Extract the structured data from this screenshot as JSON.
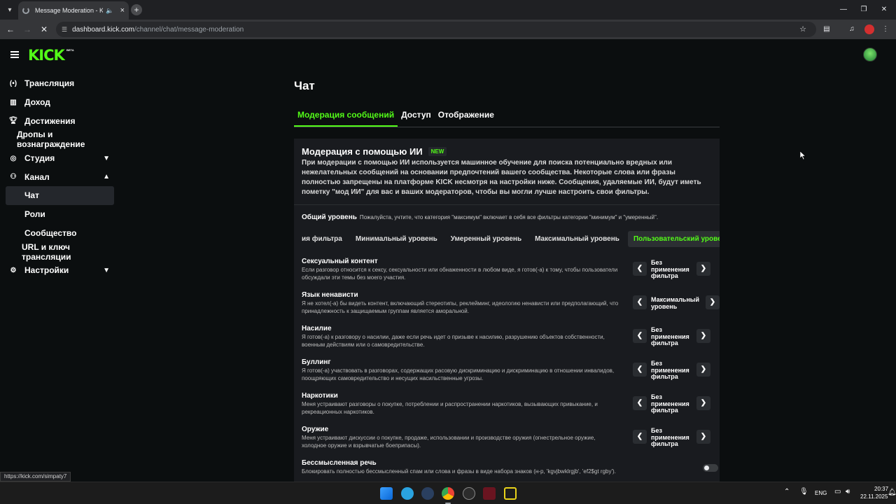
{
  "browser": {
    "tab_title": "Message Moderation - Kick",
    "url_host": "dashboard.kick.com",
    "url_path": "/channel/chat/message-moderation",
    "status_url": "https://kick.com/simpaty7",
    "icons": [
      "tab-list-icon",
      "loading-spinner-icon",
      "audio-icon",
      "close-icon",
      "new-tab-icon",
      "back-icon",
      "forward-icon",
      "stop-icon",
      "site-info-icon",
      "star-icon",
      "tab-search-icon",
      "media-icon",
      "profile-icon",
      "menu-icon",
      "minimize-icon",
      "restore-icon",
      "close-window-icon"
    ]
  },
  "header": {
    "logo": "KICK",
    "beta": "BETA"
  },
  "sidebar": {
    "items": [
      {
        "label": "Трансляция",
        "icon": "broadcast-icon"
      },
      {
        "label": "Доход",
        "icon": "income-icon"
      },
      {
        "label": "Достижения",
        "icon": "trophy-icon"
      },
      {
        "label": "Дропы и вознаграждение"
      },
      {
        "label": "Студия",
        "icon": "studio-icon"
      },
      {
        "label": "Канал",
        "icon": "channel-icon"
      },
      {
        "label": "Чат"
      },
      {
        "label": "Роли"
      },
      {
        "label": "Сообщество"
      },
      {
        "label": "URL и ключ трансляции"
      },
      {
        "label": "Настройки",
        "icon": "gear-icon"
      }
    ]
  },
  "main": {
    "title": "Чат",
    "tabs": [
      "Модерация сообщений",
      "Доступ",
      "Отображение"
    ],
    "ai": {
      "title": "Модерация с помощью ИИ",
      "badge": "NEW",
      "description": "При модерации с помощью ИИ используется машинное обучение для поиска потенциально вредных или нежелательных сообщений на основании предпочтений вашего сообщества. Некоторые слова или фразы полностью запрещены на платформе KICK несмотря на настройки ниже. Сообщения, удаляемые ИИ, будут иметь пометку \"мод ИИ\" для вас и ваших модераторов, чтобы вы могли лучше настроить свои фильтры."
    },
    "level": {
      "title": "Общий уровень",
      "note": "Пожалуйста, учтите, что категория \"максимум\" включает в себя все фильтры категории \"минимум\" и \"умеренный\"."
    },
    "presets": [
      "ия фильтра",
      "Минимальный уровень",
      "Умеренный уровень",
      "Максимальный уровень",
      "Пользовательский уровень"
    ],
    "categories": [
      {
        "name": "Сексуальный контент",
        "desc": "Если разговор относится к сексу, сексуальности или обнаженности в любом виде, я готов(-а) к тому, чтобы пользователи обсуждали эти темы без моего участия.",
        "value": "Без применения фильтра"
      },
      {
        "name": "Язык ненависти",
        "desc": "Я не хотел(-а) бы видеть контент, включающий стереотипы, реклейминг, идеологию ненависти или предполагающий, что принадлежность к защищаемым группам является аморальной.",
        "value": "Максимальный уровень"
      },
      {
        "name": "Насилие",
        "desc": "Я готов(-а) к разговору о насилии, даже если речь идет о призыве к насилию, разрушению объектов собственности, военным действиям или о самовредительстве.",
        "value": "Без применения фильтра"
      },
      {
        "name": "Буллинг",
        "desc": "Я готов(-а) участвовать в разговорах, содержащих расовую дискриминацию и дискриминацию в отношении инвалидов, поощряющих самовредительство и несущих насильственные угрозы.",
        "value": "Без применения фильтра"
      },
      {
        "name": "Наркотики",
        "desc": "Меня устраивают разговоры о покупке, потреблении и распространении наркотиков, вызывающих привыкание, и рекреационных наркотиков.",
        "value": "Без применения фильтра"
      },
      {
        "name": "Оружие",
        "desc": "Меня устраивают дискуссии о покупке, продаже, использовании и производстве оружия (огнестрельное оружие, холодное оружие и взрывчатые боеприпасы).",
        "value": "Без применения фильтра"
      },
      {
        "name": "Бессмысленная речь",
        "desc": "Блокировать полностью бессмысленный спам или слова и фразы в виде набора знаков (н-р, 'kgvjbwklrgjb', 'ef2$gt rgby')."
      }
    ]
  },
  "taskbar": {
    "lang": "ENG",
    "time": "20:37",
    "date": "22.11.2025"
  },
  "colors": {
    "accent": "#53fc18",
    "background": "#0b0e0f",
    "card": "#191b1f"
  }
}
